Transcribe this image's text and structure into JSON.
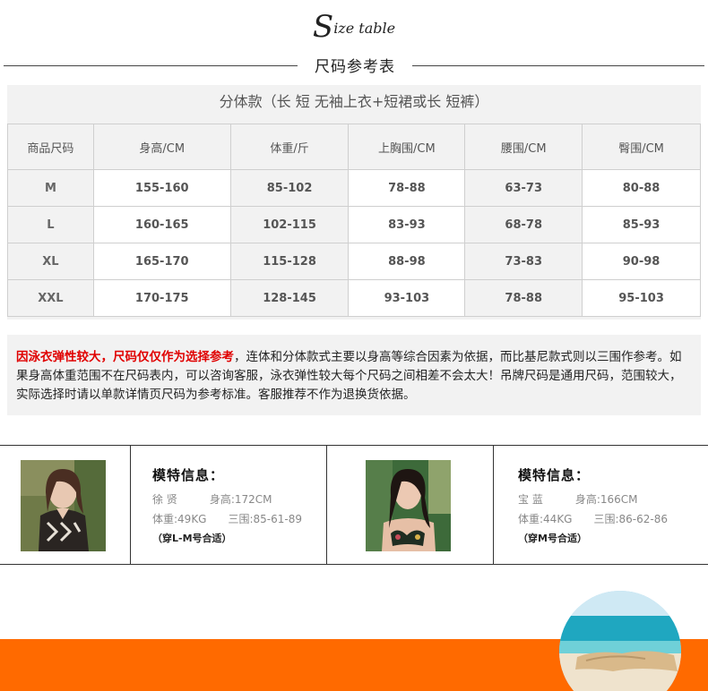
{
  "header": {
    "script_cap": "S",
    "script_rest": "ize table",
    "title": "尺码参考表"
  },
  "table": {
    "caption": "分体款（长 短 无袖上衣+短裙或长 短裤）",
    "columns": [
      "商品尺码",
      "身高/CM",
      "体重/斤",
      "上胸围/CM",
      "腰围/CM",
      "臀围/CM"
    ],
    "rows": [
      [
        "M",
        "155-160",
        "85-102",
        "78-88",
        "63-73",
        "80-88"
      ],
      [
        "L",
        "160-165",
        "102-115",
        "83-93",
        "68-78",
        "85-93"
      ],
      [
        "XL",
        "165-170",
        "115-128",
        "88-98",
        "73-83",
        "90-98"
      ],
      [
        "XXL",
        "170-175",
        "128-145",
        "93-103",
        "78-88",
        "95-103"
      ]
    ]
  },
  "notice": {
    "highlight": "因泳衣弹性较大，尺码仅仅作为选择参考",
    "body": "，连体和分体款式主要以身高等综合因素为依据，而比基尼款式则以三围作参考。如果身高体重范围不在尺码表内，可以咨询客服，泳衣弹性较大每个尺码之间相差不会太大！吊牌尺码是通用尺码，范围较大，实际选择时请以单款详情页尺码为参考标准。客服推荐不作为退换货依据。"
  },
  "models": [
    {
      "heading": "模特信息：",
      "name": "徐 贤",
      "height": "身高:172CM",
      "weight": "体重:49KG",
      "measurements": "三围:85-61-89",
      "fit": "（穿L-M号合适）"
    },
    {
      "heading": "模特信息：",
      "name": "宝 蓝",
      "height": "身高:166CM",
      "weight": "体重:44KG",
      "measurements": "三围:86-62-86",
      "fit": "（穿M号合适）"
    }
  ],
  "colors": {
    "accent_orange": "#ff6a00",
    "notice_red": "#e00000",
    "table_bg": "#f2f2f2"
  }
}
